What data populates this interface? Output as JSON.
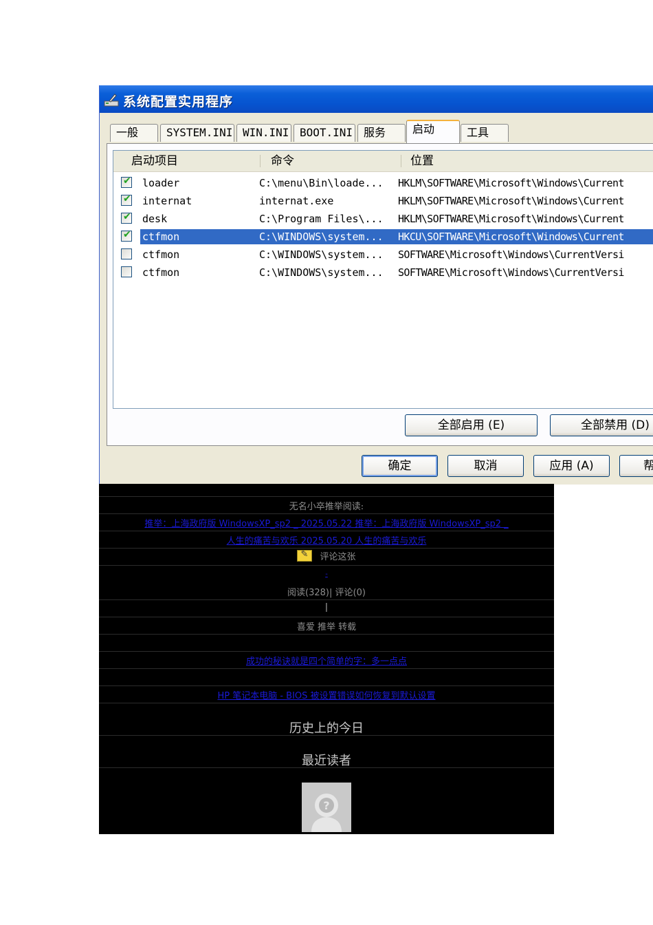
{
  "window": {
    "title": "系统配置实用程序",
    "tabs": [
      "一般",
      "SYSTEM.INI",
      "WIN.INI",
      "BOOT.INI",
      "服务",
      "启动",
      "工具"
    ],
    "active_tab": "启动",
    "columns": [
      "启动项目",
      "命令",
      "位置"
    ],
    "rows": [
      {
        "checked": true,
        "item": "loader",
        "command": "C:\\menu\\Bin\\loade...",
        "location": "HKLM\\SOFTWARE\\Microsoft\\Windows\\Current",
        "selected": false
      },
      {
        "checked": true,
        "item": "internat",
        "command": "internat.exe",
        "location": "HKLM\\SOFTWARE\\Microsoft\\Windows\\Current",
        "selected": false
      },
      {
        "checked": true,
        "item": "desk",
        "command": "C:\\Program Files\\...",
        "location": "HKLM\\SOFTWARE\\Microsoft\\Windows\\Current",
        "selected": false
      },
      {
        "checked": true,
        "item": "ctfmon",
        "command": "C:\\WINDOWS\\system...",
        "location": "HKCU\\SOFTWARE\\Microsoft\\Windows\\Current",
        "selected": true
      },
      {
        "checked": false,
        "item": "ctfmon",
        "command": "C:\\WINDOWS\\system...",
        "location": "SOFTWARE\\Microsoft\\Windows\\CurrentVersi",
        "selected": false
      },
      {
        "checked": false,
        "item": "ctfmon",
        "command": "C:\\WINDOWS\\system...",
        "location": "SOFTWARE\\Microsoft\\Windows\\CurrentVersi",
        "selected": false
      }
    ],
    "enable_all": "全部启用 (E)",
    "disable_all": "全部禁用 (D)",
    "ok": "确定",
    "cancel": "取消",
    "apply": "应用 (A)",
    "help": "帮"
  },
  "blog": {
    "recommend_label": "无名小卒推举阅读:",
    "link1": "推举：上海政府版 WindowsXP_sp2 _ 2025.05.22 推举：上海政府版 WindowsXP_sp2 _",
    "link2": "人生的痛苦与欢乐 2025.05.20 人生的痛苦与欢乐",
    "comment_pic": "评论这张",
    "dash": "-",
    "stats": "阅读(328)| 评论(0)",
    "bar": "|",
    "actions": "喜爱 推举 转载",
    "prev_post": "成功的秘诀就是四个简单的字：多一点点",
    "next_post": "HP 笔记本电脑 - BIOS 被设置错误如何恢复到默认设置",
    "history_heading": "历史上的今日",
    "readers_heading": "最近读者"
  }
}
